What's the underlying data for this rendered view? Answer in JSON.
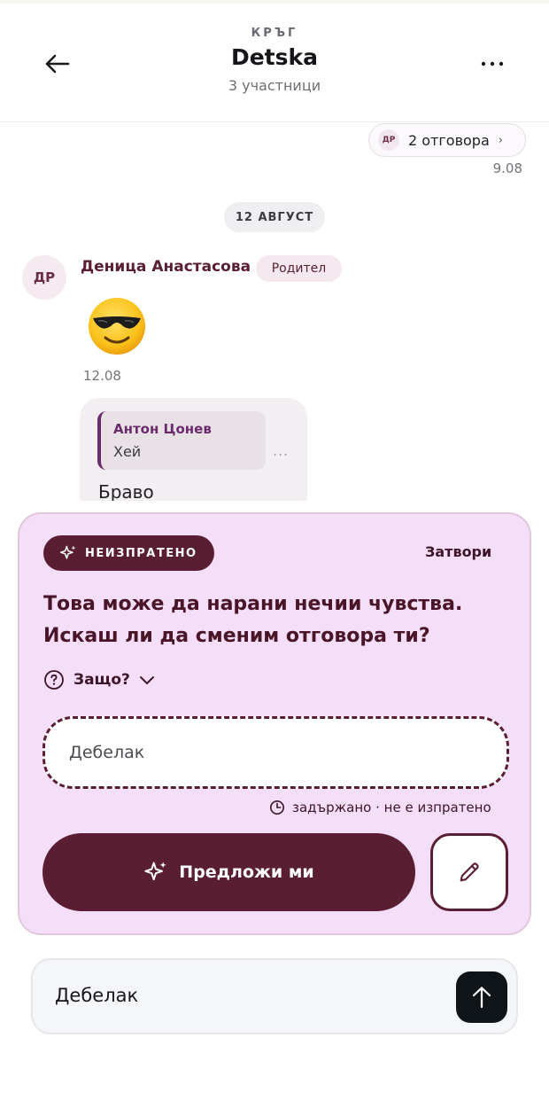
{
  "header": {
    "kicker": "КРЪГ",
    "title": "Detska",
    "subtitle": "3 участници",
    "back_icon": "arrow-left-icon",
    "more_icon": "more-horizontal-icon"
  },
  "thread": {
    "replies": {
      "avatar_initials": "ДР",
      "label": "2 отговора",
      "chevron": "›"
    },
    "replies_time": "9.08",
    "date_separator": "12 АВГУСТ",
    "message": {
      "avatar_initials": "ДР",
      "sender": "Деница Анастасова",
      "role": "Родител",
      "emoji": "smiling-face-with-sunglasses",
      "time": "12.08"
    },
    "reply_bubble": {
      "quote_author": "Антон Цонев",
      "quote_text": "Хей",
      "more": "...",
      "text": "Браво"
    }
  },
  "warning_card": {
    "status_chip": "НЕИЗПРАТЕНО",
    "close_label": "Затвори",
    "title": "Това може да нарани нечии чувства. Искаш ли да сменим отговора ти?",
    "why_label": "Защо?",
    "draft_text": "Дебелак",
    "held_status": "задържано · не е изпратено",
    "suggest_label": "Предложи ми",
    "edit_icon": "pencil-icon"
  },
  "composer": {
    "value": "Дебелак",
    "send_icon": "arrow-up-icon"
  },
  "colors": {
    "brand": "#5a1e33",
    "card_bg": "#f5defa",
    "send_bg": "#0f1418"
  }
}
